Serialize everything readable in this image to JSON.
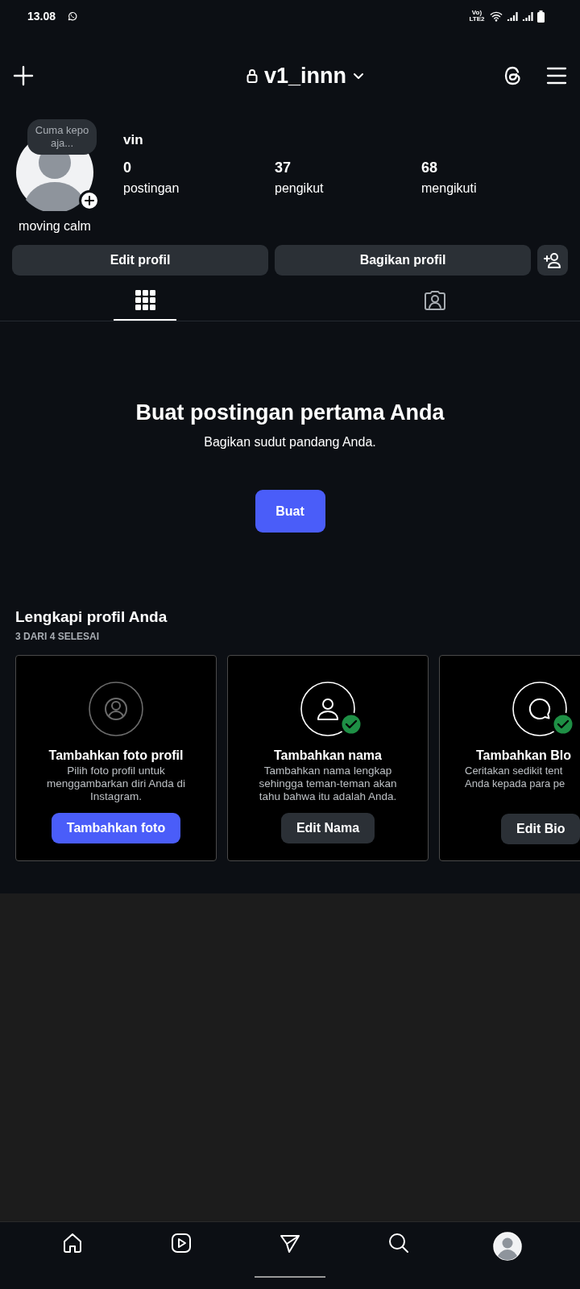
{
  "status_bar": {
    "time": "13.08",
    "network_label": "Vo) LTE2"
  },
  "top_bar": {
    "username": "v1_innn",
    "private": true
  },
  "profile": {
    "note": "Cuma kepo aja...",
    "name": "vin",
    "bio": "moving calm",
    "stats": [
      {
        "value": "0",
        "label": "postingan"
      },
      {
        "value": "37",
        "label": "pengikut"
      },
      {
        "value": "68",
        "label": "mengikuti"
      }
    ]
  },
  "buttons": [
    "Edit profil",
    "Bagikan profil"
  ],
  "tabs": [
    {
      "kind": "grid",
      "selected": true
    },
    {
      "kind": "tagged",
      "selected": false
    }
  ],
  "empty_state": {
    "title": "Buat postingan pertama Anda",
    "subtitle": "Bagikan sudut pandang Anda.",
    "button": "Buat"
  },
  "complete_profile": {
    "title": "Lengkapi profil Anda",
    "progress": "**3 DARI 4** SELESAI",
    "cards": [
      {
        "kind": "photo",
        "done": false,
        "clipped": false,
        "title": "Tambahkan foto profil",
        "description": "Pilih foto profil untuk menggambarkan diri Anda di Instagram.",
        "button": "Tambahkan foto",
        "primary": true
      },
      {
        "kind": "name",
        "done": true,
        "clipped": false,
        "title": "Tambahkan nama",
        "description": "Tambahkan nama lengkap sehingga teman-teman akan tahu bahwa itu adalah Anda.",
        "button": "Edit Nama",
        "primary": false
      },
      {
        "kind": "bio",
        "done": true,
        "clipped": true,
        "title": "Tambahkan Blo",
        "description_lines": [
          "Ceritakan sedikit tent",
          "Anda kepada para pe"
        ],
        "button": "Edit Bio",
        "primary": false
      }
    ]
  },
  "nav": [
    {
      "kind": "home",
      "selected": false
    },
    {
      "kind": "reels",
      "selected": false
    },
    {
      "kind": "direct",
      "selected": false
    },
    {
      "kind": "search",
      "selected": false
    },
    {
      "kind": "profile",
      "selected": true
    }
  ]
}
